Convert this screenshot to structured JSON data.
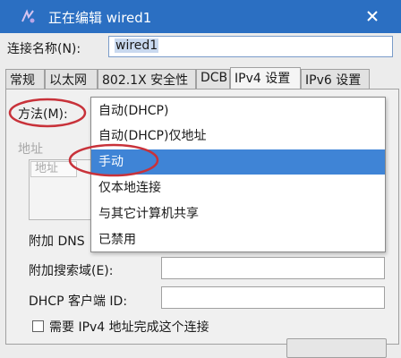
{
  "window": {
    "title": "正在编辑 wired1"
  },
  "connection": {
    "label": "连接名称(N):",
    "value": "wired1"
  },
  "tabs": [
    {
      "label": "常规"
    },
    {
      "label": "以太网"
    },
    {
      "label": "802.1X 安全性"
    },
    {
      "label": "DCB"
    },
    {
      "label": "IPv4 设置",
      "active": true
    },
    {
      "label": "IPv6 设置"
    }
  ],
  "ipv4": {
    "method_label": "方法(M):",
    "addresses_title": "地址",
    "addresses_column": "地址",
    "dns_label": "附加 DNS",
    "search_label": "附加搜索域(E):",
    "search_value": "",
    "dhcp_label": "DHCP 客户端 ID:",
    "dhcp_value": "",
    "require_label": "需要 IPv4 地址完成这个连接",
    "require_checked": false
  },
  "method_dropdown": {
    "options": [
      {
        "label": "自动(DHCP)"
      },
      {
        "label": "自动(DHCP)仅地址"
      },
      {
        "label": "手动",
        "highlighted": true
      },
      {
        "label": "仅本地连接"
      },
      {
        "label": "与其它计算机共享"
      },
      {
        "label": "已禁用"
      }
    ]
  },
  "colors": {
    "titlebar": "#2b6fc2",
    "highlight": "#3f84d6",
    "annotation": "#c8323a"
  },
  "icons": {
    "app": "network-edit-icon",
    "close": "close-icon",
    "checkbox": "checkbox-icon"
  }
}
